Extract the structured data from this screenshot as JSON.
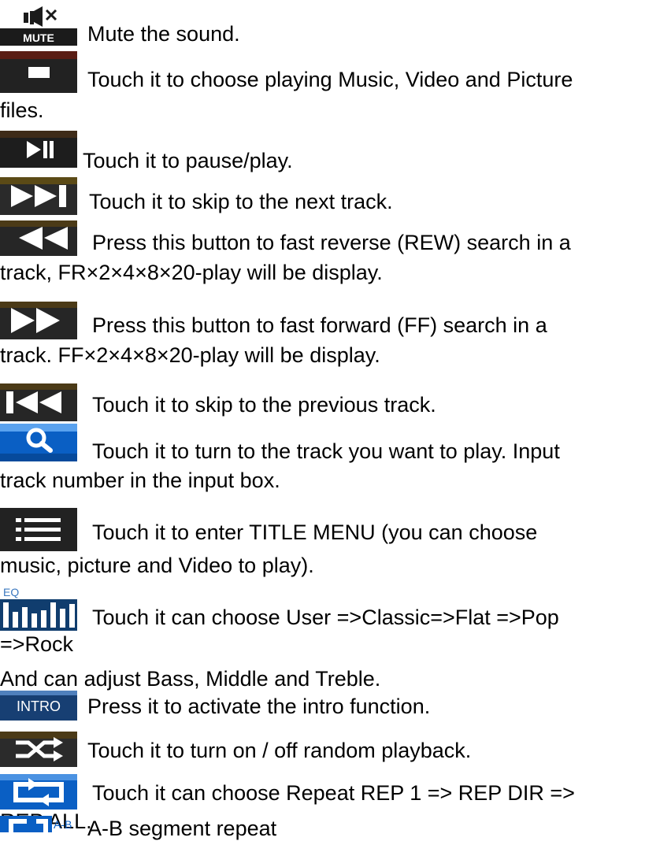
{
  "icons": {
    "mute": {
      "name": "mute-icon",
      "label": "MUTE"
    },
    "stop": {
      "name": "stop-icon"
    },
    "play_pause": {
      "name": "play-pause-icon"
    },
    "next": {
      "name": "skip-next-icon"
    },
    "rewind": {
      "name": "rewind-icon"
    },
    "fast_forward": {
      "name": "fast-forward-icon"
    },
    "previous": {
      "name": "skip-previous-icon"
    },
    "search": {
      "name": "search-icon"
    },
    "menu": {
      "name": "menu-icon"
    },
    "eq": {
      "name": "equalizer-icon",
      "label": "EQ"
    },
    "intro": {
      "name": "intro-icon",
      "label": "INTRO"
    },
    "shuffle": {
      "name": "shuffle-icon"
    },
    "repeat": {
      "name": "repeat-icon"
    },
    "ab_repeat": {
      "name": "ab-repeat-icon",
      "label": "A-B"
    }
  },
  "colors": {
    "icon_dark": "#1b1b1b",
    "icon_blue": "#0a5fc4",
    "text": "#000000"
  },
  "entries": {
    "mute": [
      "Mute the sound."
    ],
    "stop": [
      "Touch it to choose playing Music, Video and Picture",
      "files."
    ],
    "play_pause": [
      "Touch it to pause/play."
    ],
    "next": [
      "Touch it to skip to the next track."
    ],
    "rewind": [
      "Press this button to fast reverse (REW) search in a",
      "track, FR×2×4×8×20-play will be display."
    ],
    "fast_forward": [
      "Press this button to fast forward (FF) search in a",
      "track. FF×2×4×8×20-play will be display."
    ],
    "previous": [
      "Touch it to skip to the previous track."
    ],
    "search": [
      "Touch it to turn to the track you want to play. Input",
      "track number in the input box."
    ],
    "menu": [
      "Touch it to enter TITLE MENU (you can choose",
      "music, picture and Video to play)."
    ],
    "eq": [
      "Touch it can choose User =>Classic=>Flat =>Pop",
      "=>Rock",
      "And can adjust Bass, Middle and Treble."
    ],
    "intro": [
      "Press it to activate the intro function."
    ],
    "shuffle": [
      "Touch it to turn on / off random playback."
    ],
    "repeat": [
      "Touch it can choose Repeat REP 1 => REP DIR =>",
      "REP ALL."
    ],
    "ab_repeat": [
      "A-B segment repeat"
    ]
  }
}
